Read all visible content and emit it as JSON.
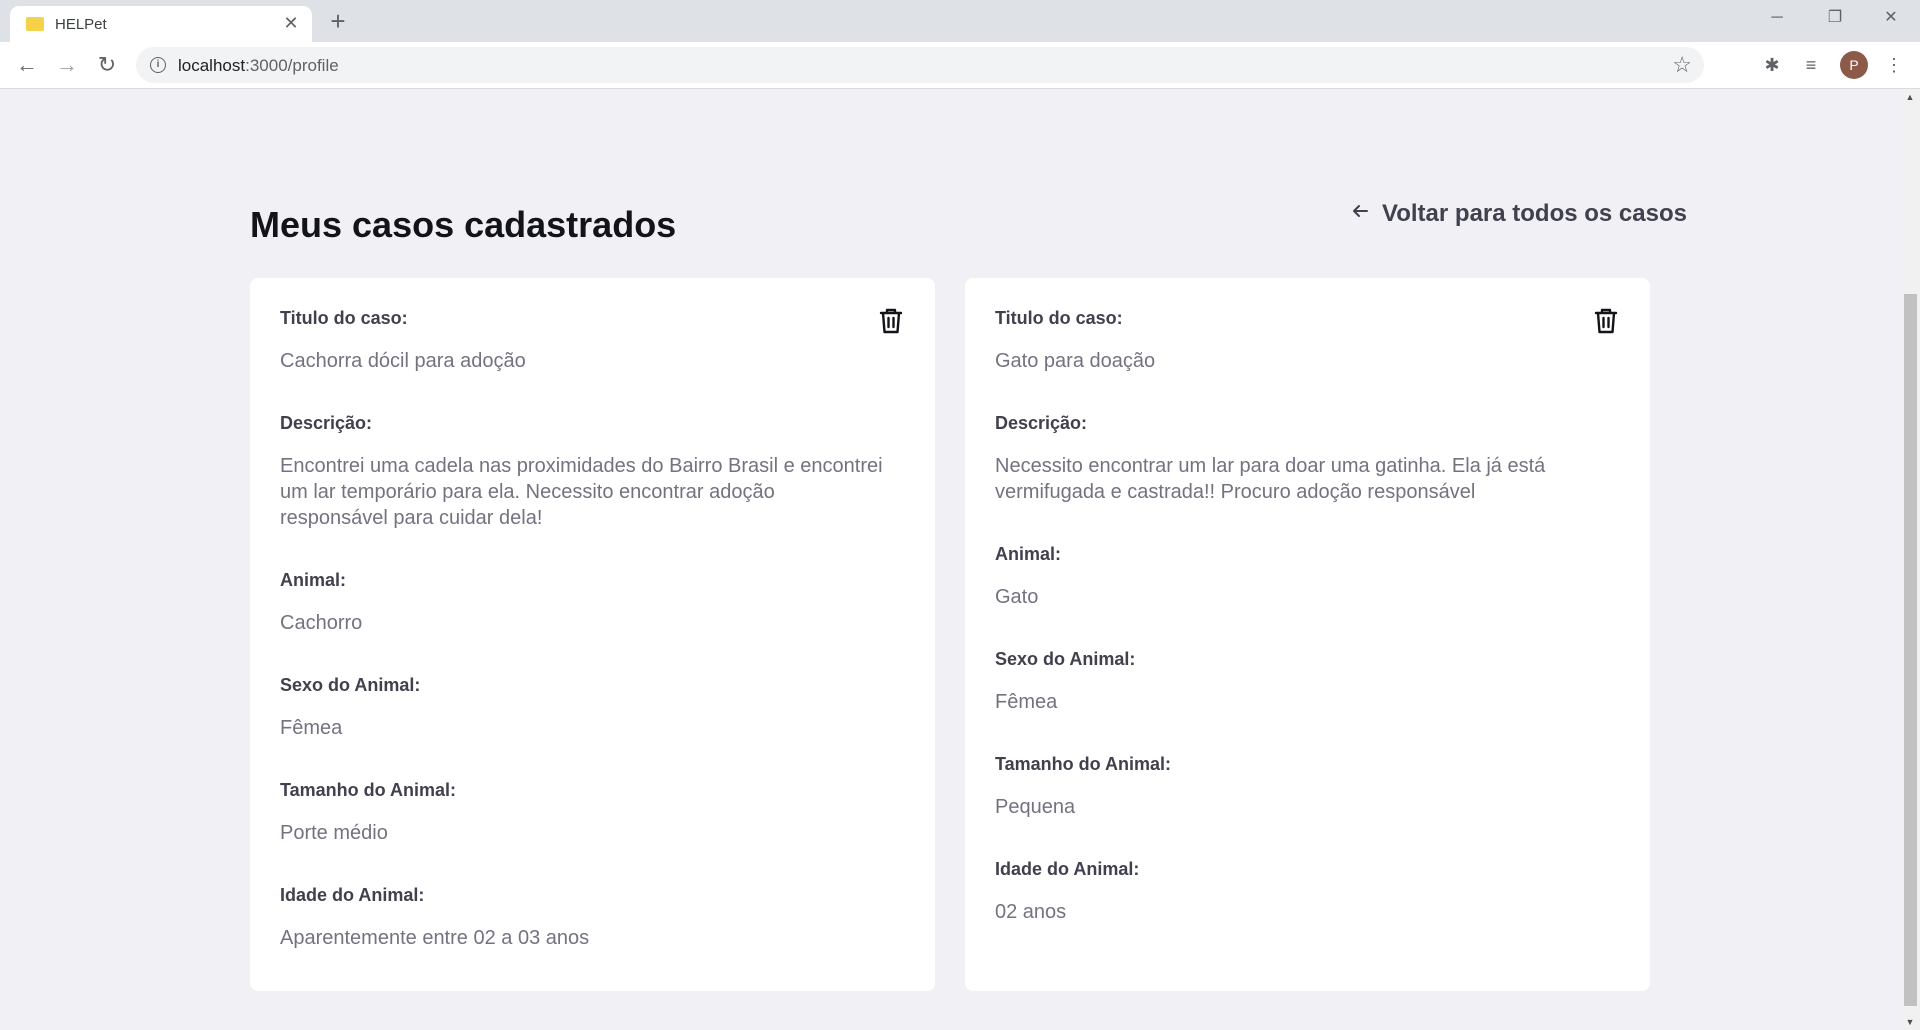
{
  "browser": {
    "tab_title": "HELPet",
    "url_host": "localhost",
    "url_path": ":3000/profile",
    "profile_initial": "P"
  },
  "page": {
    "title": "Meus casos cadastrados",
    "back_link": "Voltar para todos os casos"
  },
  "labels": {
    "title": "Titulo do caso:",
    "description": "Descrição:",
    "animal": "Animal:",
    "sex": "Sexo do Animal:",
    "size": "Tamanho do Animal:",
    "age": "Idade do Animal:"
  },
  "cases": [
    {
      "title": "Cachorra dócil para adoção",
      "description": "Encontrei uma cadela nas proximidades do Bairro Brasil e encontrei um lar temporário para ela. Necessito encontrar adoção responsável para cuidar dela!",
      "animal": "Cachorro",
      "sex": "Fêmea",
      "size": "Porte médio",
      "age": "Aparentemente entre 02 a 03 anos"
    },
    {
      "title": "Gato para doação",
      "description": "Necessito encontrar um lar para doar uma gatinha. Ela já está vermifugada e castrada!! Procuro adoção responsável",
      "animal": "Gato",
      "sex": "Fêmea",
      "size": "Pequena",
      "age": "02 anos"
    }
  ],
  "icons": {
    "back": "arrow-left-icon",
    "delete": "trash-icon"
  },
  "colors": {
    "background": "#f0f0f5",
    "title": "#13131a",
    "label": "#41414d",
    "value": "#737380",
    "card": "#ffffff"
  }
}
